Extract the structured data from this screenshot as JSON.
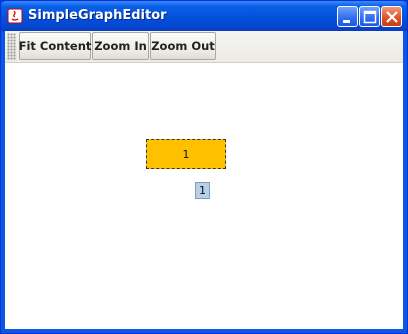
{
  "window": {
    "title": "SimpleGraphEditor",
    "controls": {
      "minimize": "minimize-icon",
      "maximize": "maximize-icon",
      "close": "close-icon"
    }
  },
  "toolbar": {
    "buttons": [
      {
        "label": "Fit Content"
      },
      {
        "label": "Zoom In"
      },
      {
        "label": "Zoom Out"
      }
    ]
  },
  "graph": {
    "vertex": {
      "label": "1",
      "fill": "#ffc000"
    },
    "vertex_tag": {
      "label": "1",
      "fill": "#b7cfe8"
    }
  }
}
